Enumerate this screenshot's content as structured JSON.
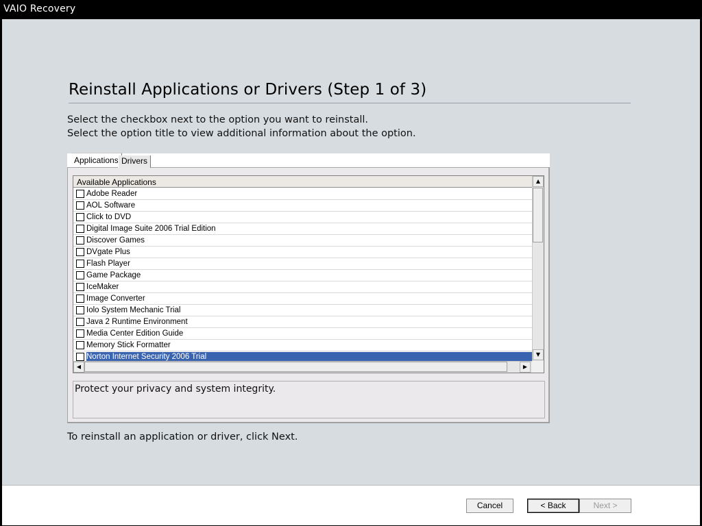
{
  "window": {
    "title": "VAIO Recovery"
  },
  "page": {
    "heading": "Reinstall Applications or Drivers (Step 1 of 3)",
    "instruction_1": "Select the checkbox next to the option you want to reinstall.",
    "instruction_2": "Select the option title to view additional information about the option.",
    "footer_hint": "To reinstall an application or driver, click Next."
  },
  "tabs": [
    {
      "label": "Applications",
      "selected": true
    },
    {
      "label": "Drivers",
      "selected": false
    }
  ],
  "list": {
    "header": "Available Applications",
    "items": [
      {
        "label": "Adobe Reader",
        "checked": false
      },
      {
        "label": "AOL Software",
        "checked": false
      },
      {
        "label": "Click to DVD",
        "checked": false
      },
      {
        "label": "Digital Image Suite 2006 Trial Edition",
        "checked": false
      },
      {
        "label": "Discover Games",
        "checked": false
      },
      {
        "label": "DVgate Plus",
        "checked": false
      },
      {
        "label": "Flash Player",
        "checked": false
      },
      {
        "label": "Game Package",
        "checked": false
      },
      {
        "label": "IceMaker",
        "checked": false
      },
      {
        "label": "Image Converter",
        "checked": false
      },
      {
        "label": "Iolo System Mechanic Trial",
        "checked": false
      },
      {
        "label": "Java 2 Runtime Environment",
        "checked": false
      },
      {
        "label": "Media Center Edition Guide",
        "checked": false
      },
      {
        "label": "Memory Stick Formatter",
        "checked": false
      },
      {
        "label": "Norton Internet Security 2006 Trial",
        "checked": false,
        "selected": true
      }
    ]
  },
  "description": "Protect your privacy and system integrity.",
  "buttons": {
    "cancel": "Cancel",
    "back": "< Back",
    "next": "Next >"
  },
  "icons": {
    "scroll_up": "▲",
    "scroll_down": "▼",
    "scroll_left": "◀",
    "scroll_right": "▶"
  }
}
